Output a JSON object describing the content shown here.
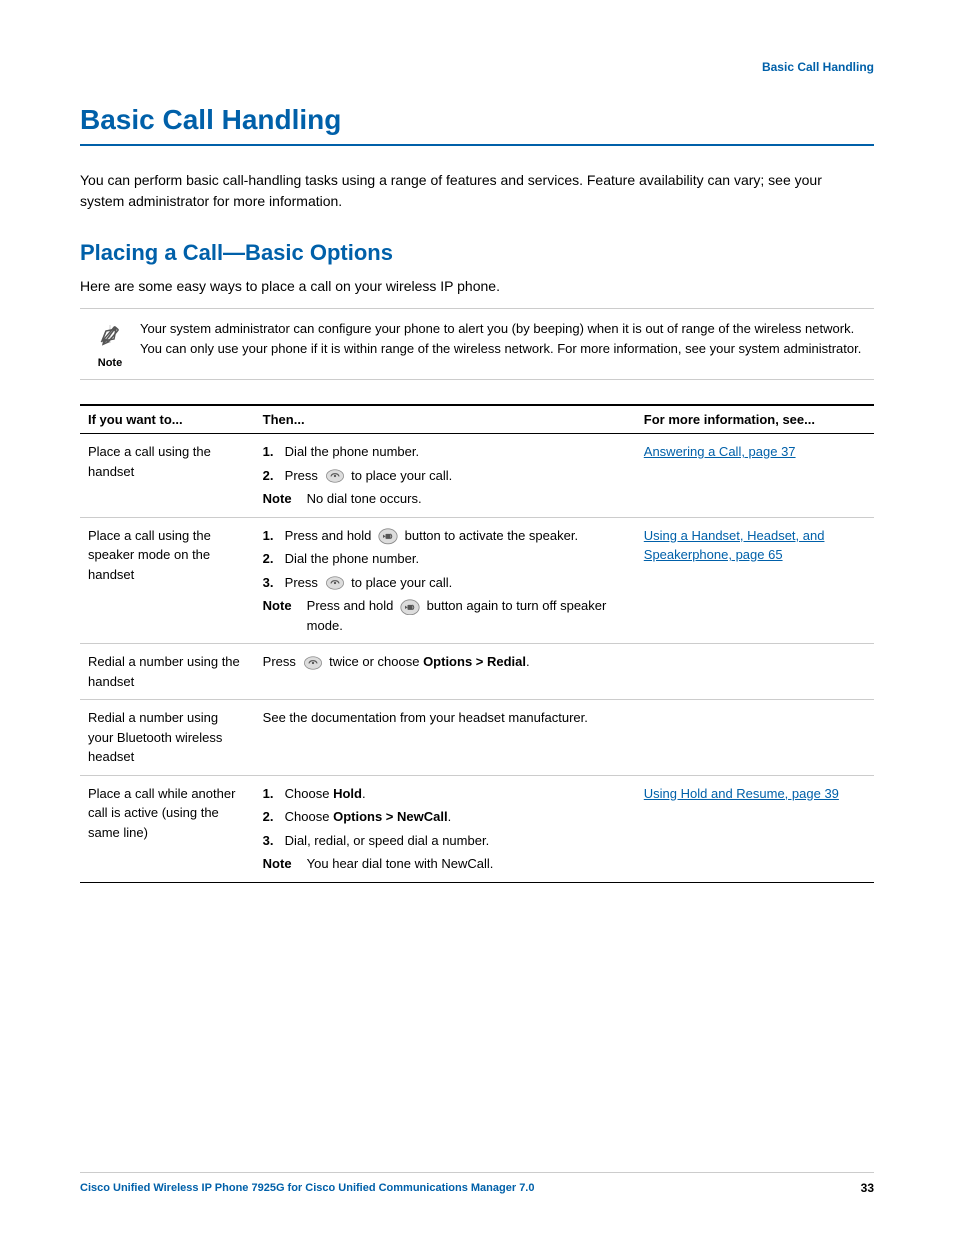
{
  "header": {
    "section_label": "Basic Call Handling"
  },
  "page_title": "Basic Call Handling",
  "intro": "You can perform basic call-handling tasks using a range of features and services. Feature availability can vary; see your system administrator for more information.",
  "section_title": "Placing a Call—Basic Options",
  "section_intro": "Here are some easy ways to place a call on your wireless IP phone.",
  "note": {
    "label": "Note",
    "text": "Your system administrator can configure your phone to alert you (by beeping) when it is out of range of the wireless network. You can only use your phone if it is within range of the wireless network. For more information, see your system administrator."
  },
  "table": {
    "col1_header": "If you want to...",
    "col2_header": "Then...",
    "col3_header": "For more information, see...",
    "rows": [
      {
        "if": "Place a call using the handset",
        "then_steps": [
          "Dial the phone number.",
          "Press [phone] to place your call."
        ],
        "then_note": "No dial tone occurs.",
        "more": "Answering a Call, page 37",
        "more_link": true
      },
      {
        "if": "Place a call using the speaker mode on the handset",
        "then_steps": [
          "Press and hold [speaker] button to activate the speaker.",
          "Dial the phone number.",
          "Press [phone] to place your call."
        ],
        "then_note": "Press and hold [speaker] button again to turn off speaker mode.",
        "more": "Using a Handset, Headset, and Speakerphone, page 65",
        "more_link": true
      },
      {
        "if": "Redial a number using the handset",
        "then_single": "Press [phone] twice or choose Options > Redial.",
        "more": "",
        "more_link": false
      },
      {
        "if": "Redial a number using your Bluetooth wireless headset",
        "then_single": "See the documentation from your headset manufacturer.",
        "more": "",
        "more_link": false
      },
      {
        "if": "Place a call while another call is active (using the same line)",
        "then_steps": [
          "Choose Hold.",
          "Choose Options > NewCall.",
          "Dial, redial, or speed dial a number."
        ],
        "then_note": "You hear dial tone with NewCall.",
        "more": "Using Hold and Resume, page 39",
        "more_link": true
      }
    ]
  },
  "footer": {
    "left": "Cisco Unified Wireless IP Phone 7925G for Cisco Unified Communications Manager 7.0",
    "right": "33"
  }
}
